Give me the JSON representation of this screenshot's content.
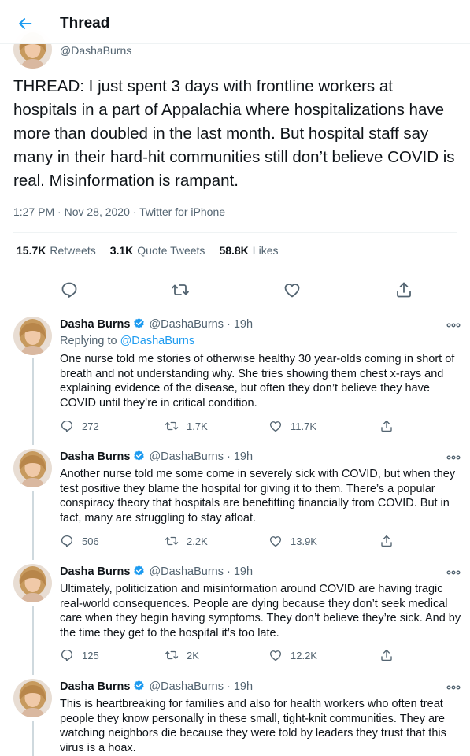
{
  "header": {
    "title": "Thread"
  },
  "main_tweet": {
    "handle": "@DashaBurns",
    "text": "THREAD: I just spent 3 days with frontline workers at hospitals in a part of Appalachia where hospitalizations have more than doubled in the last month. But hospital staff say many in their hard-hit communities still don’t believe COVID is real. Misinformation is rampant.",
    "time": "1:27 PM · Nov 28, 2020",
    "source": "Twitter for iPhone",
    "stats": {
      "retweets_count": "15.7K",
      "retweets_label": "Retweets",
      "quotes_count": "3.1K",
      "quotes_label": "Quote Tweets",
      "likes_count": "58.8K",
      "likes_label": "Likes"
    }
  },
  "replies": [
    {
      "name": "Dasha Burns",
      "handle": "@DashaBurns",
      "age": "19h",
      "replying_prefix": "Replying to",
      "replying_to": "@DashaBurns",
      "text": "One nurse told me stories of otherwise healthy 30 year-olds coming in short of breath and not understanding why. She tries showing them chest x-rays and explaining evidence of the disease, but often they don’t believe they have COVID until they’re in critical condition.",
      "replies": "272",
      "retweets": "1.7K",
      "likes": "11.7K"
    },
    {
      "name": "Dasha Burns",
      "handle": "@DashaBurns",
      "age": "19h",
      "text": "Another nurse told me some come in severely sick with COVID, but when they test positive they blame the hospital for giving it to them. There’s a popular conspiracy theory that hospitals are benefitting financially from COVID. But in fact, many are struggling to stay afloat.",
      "replies": "506",
      "retweets": "2.2K",
      "likes": "13.9K"
    },
    {
      "name": "Dasha Burns",
      "handle": "@DashaBurns",
      "age": "19h",
      "text": "Ultimately, politicization and misinformation around COVID are having tragic real-world consequences. People are dying because they don’t seek medical care when they begin having symptoms. They don’t believe they’re sick. And by the time they get to the hospital it’s too late.",
      "replies": "125",
      "retweets": "2K",
      "likes": "12.2K"
    },
    {
      "name": "Dasha Burns",
      "handle": "@DashaBurns",
      "age": "19h",
      "text": "This is heartbreaking for families and also for health workers who often treat people they know personally in these small, tight-knit communities. They are watching neighbors die because they were told by leaders they trust that this virus is a hoax."
    }
  ],
  "colors": {
    "accent": "#1d9bf0",
    "verified": "#1d9bf0",
    "text": "#0f1419",
    "muted": "#536471"
  },
  "icons": [
    "back-arrow-icon",
    "reply-icon",
    "retweet-icon",
    "like-icon",
    "share-icon",
    "verified-badge-icon",
    "more-icon"
  ]
}
